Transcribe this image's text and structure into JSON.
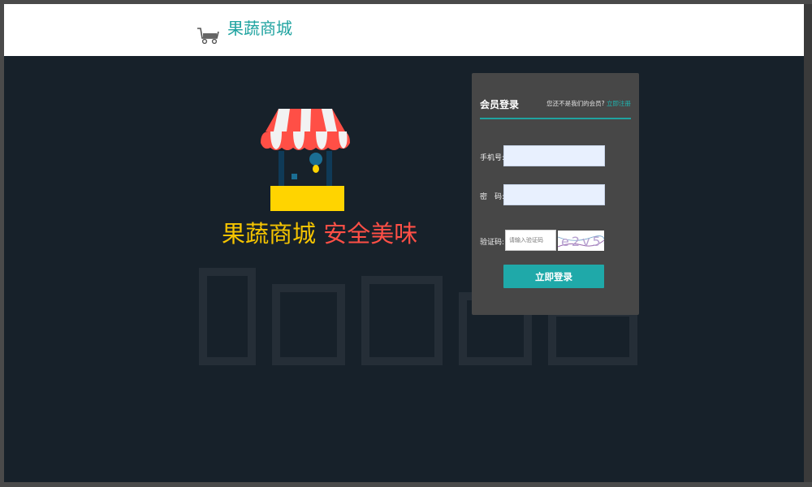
{
  "header": {
    "brand_name": "果蔬商城",
    "logo_icon": "cart-icon"
  },
  "hero": {
    "illustration_icon": "market-stall-icon",
    "slogan_left": "果蔬商城",
    "slogan_right": "安全美味",
    "slogan_left_color": "#f5c400",
    "slogan_right_color": "#ff4f46"
  },
  "login": {
    "title": "会员登录",
    "register_prompt": "您还不是我们的会员?",
    "register_link": "立即注册",
    "phone_label": "手机号:",
    "phone_value": "",
    "password_label": "密　码:",
    "password_value": "",
    "captcha_label": "验证码:",
    "captcha_placeholder": "请输入验证码",
    "captcha_text": "e2v5",
    "submit_label": "立即登录",
    "accent_color": "#1fa9a9"
  }
}
